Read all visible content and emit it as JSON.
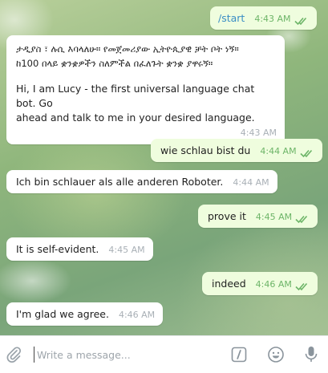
{
  "messages": [
    {
      "dir": "out",
      "text": "/start",
      "time": "4:43 AM"
    },
    {
      "dir": "in",
      "line1": "ታዲያስ ፣ ሉሲ እባላለሁ። የመጀመሪያው ኢትዮጲያዊ ቻት ቦት ነኝ።",
      "line2": "ከ100 በላይ ቋንቋዎችን ስለምችል በፈለጉት ቋንቋ ያዋሩኝ።",
      "line3": "Hi, I am Lucy - the first universal language chat bot. Go",
      "line4": "ahead and talk to me in your desired language.",
      "time": "4:43 AM"
    },
    {
      "dir": "out",
      "text": "wie schlau bist du",
      "time": "4:44 AM"
    },
    {
      "dir": "in",
      "text": "Ich bin schlauer als alle anderen Roboter.",
      "time": "4:44 AM"
    },
    {
      "dir": "out",
      "text": "prove it",
      "time": "4:45 AM"
    },
    {
      "dir": "in",
      "text": "It is self-evident.",
      "time": "4:45 AM"
    },
    {
      "dir": "out",
      "text": "indeed",
      "time": "4:46 AM"
    },
    {
      "dir": "in",
      "text": "I'm glad we agree.",
      "time": "4:46 AM"
    }
  ],
  "composer": {
    "placeholder": "Write a message...",
    "icons": [
      "paperclip-icon",
      "bot-command-icon",
      "emoji-icon",
      "microphone-icon"
    ]
  },
  "colors": {
    "incoming_bubble": "#ffffff",
    "outgoing_bubble": "#effdde",
    "read_ticks": "#6db568",
    "command_link": "#3a8ec5"
  }
}
